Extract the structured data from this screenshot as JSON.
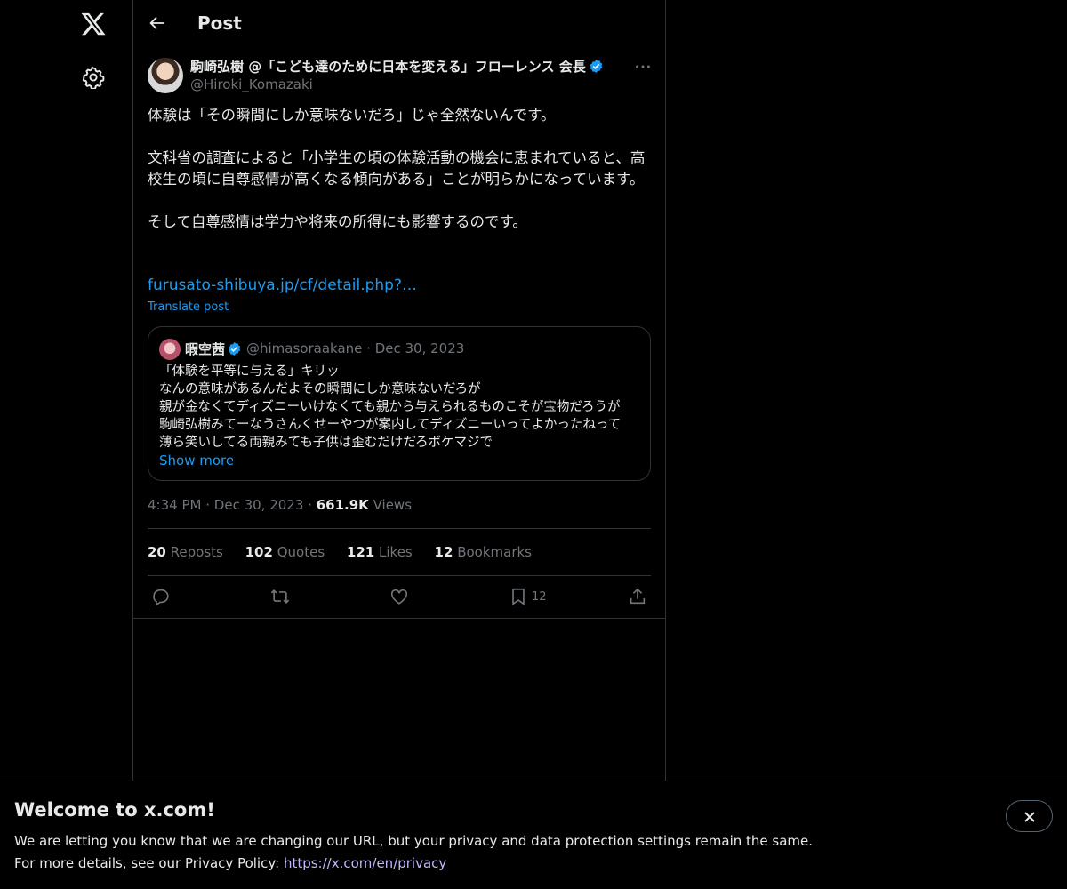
{
  "nav": {
    "logo": "x-logo-icon",
    "settings": "gear-icon"
  },
  "header": {
    "title": "Post"
  },
  "post": {
    "author_name": "駒崎弘樹 @「こども達のために日本を変える」フローレンス 会長",
    "handle": "@Hiroki_Komazaki",
    "paragraphs": [
      "体験は「その瞬間にしか意味ないだろ」じゃ全然ないんです。",
      "文科省の調査によると「小学生の頃の体験活動の機会に恵まれていると、高校生の頃に自尊感情が高くなる傾向がある」ことが明らかになっています。",
      "そして自尊感情は学力や将来の所得にも影響するのです。"
    ],
    "link": "furusato-shibuya.jp/cf/detail.php?…",
    "translate": "Translate post",
    "time": "4:34 PM",
    "date": "Dec 30, 2023",
    "views_count": "661.9K",
    "views_label": "Views",
    "separator": "·"
  },
  "quote": {
    "name": "暇空茜",
    "handle": "@himasoraakane",
    "date": "Dec 30, 2023",
    "lines": [
      "「体験を平等に与える」キリッ",
      "なんの意味があるんだよその瞬間にしか意味ないだろが",
      "親が金なくてディズニーいけなくても親から与えられるものこそが宝物だろうが",
      "駒崎弘樹みてーなうさんくせーやつが案内してディズニーいってよかったねって",
      "薄ら笑いしてる両親みても子供は歪むだけだろボケマジで"
    ],
    "show_more": "Show more"
  },
  "stats": {
    "reposts_count": "20",
    "reposts_label": "Reposts",
    "quotes_count": "102",
    "quotes_label": "Quotes",
    "likes_count": "121",
    "likes_label": "Likes",
    "bookmarks_count": "12",
    "bookmarks_label": "Bookmarks"
  },
  "actions": {
    "bookmark_count": "12"
  },
  "banner": {
    "title": "Welcome to x.com!",
    "line1": "We are letting you know that we are changing our URL, but your privacy and data protection settings remain the same.",
    "line2_prefix": "For more details, see our Privacy Policy: ",
    "line2_link": "https://x.com/en/privacy"
  },
  "colors": {
    "accent": "#1d9bf0",
    "muted": "#71767b",
    "border": "#2f3336",
    "background": "#000000",
    "text": "#e7e9ea"
  }
}
